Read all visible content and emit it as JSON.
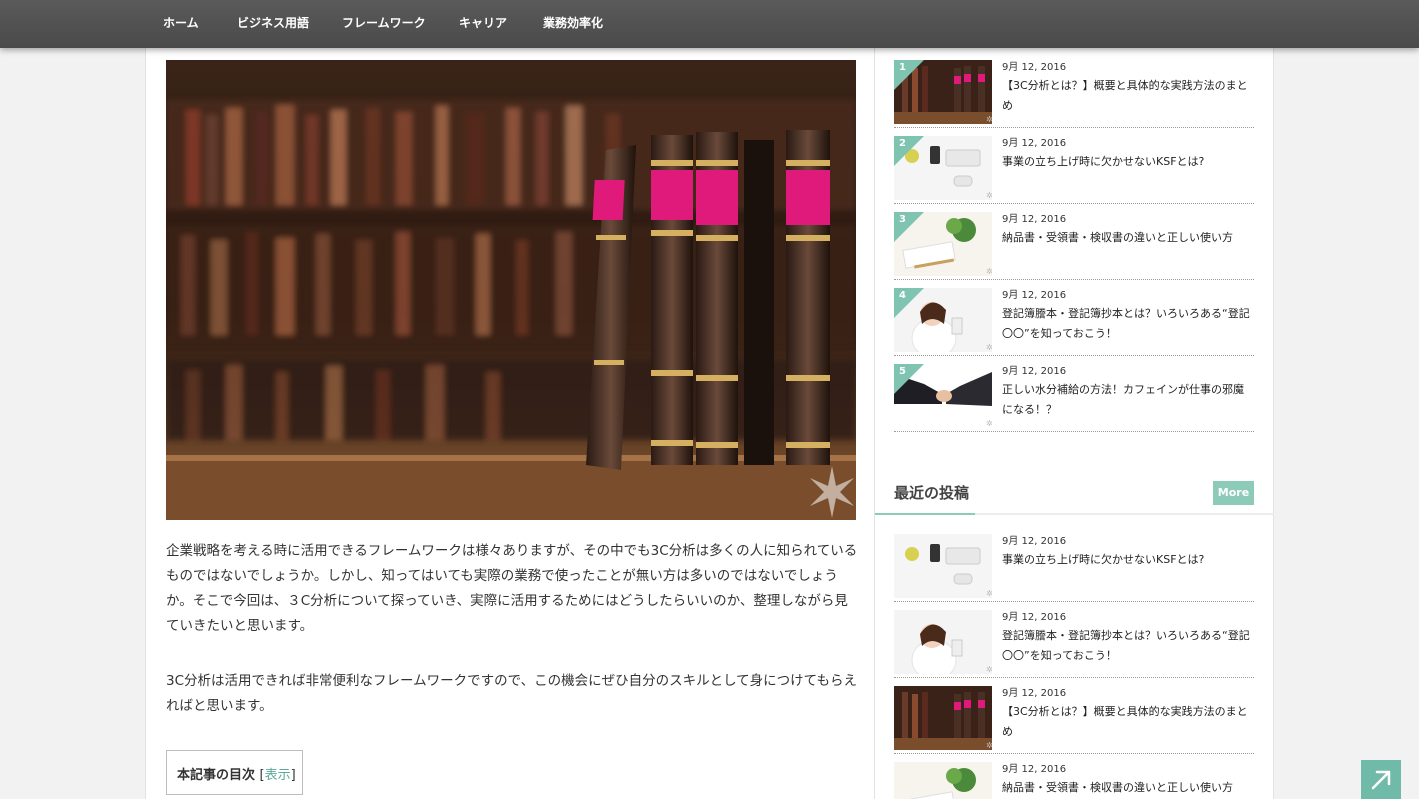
{
  "nav": {
    "items": [
      "ホーム",
      "ビジネス用語",
      "フレームワーク",
      "キャリア",
      "業務効率化"
    ]
  },
  "article": {
    "paragraph1": "企業戦略を考える時に活用できるフレームワークは様々ありますが、その中でも3C分析は多くの人に知られているものではないでしょうか。しかし、知ってはいても実際の業務で使ったことが無い方は多いのではないでしょうか。そこで今回は、３C分析について探っていき、実際に活用するためにはどうしたらいいのか、整理しながら見ていきたいと思います。",
    "paragraph2": "3C分析は活用できれば非常便利なフレームワークですので、この機会にぜひ自分のスキルとして身につけてもらえればと思います。",
    "toc_title": "本記事の目次",
    "toc_open": "[",
    "toc_toggle": "表示",
    "toc_close": "]"
  },
  "ranking": {
    "posts": [
      {
        "rank": "1",
        "date": "9月 12, 2016",
        "title": "【3C分析とは？】概要と具体的な実践方法のまとめ",
        "thumb": "books"
      },
      {
        "rank": "2",
        "date": "9月 12, 2016",
        "title": "事業の立ち上げ時に欠かせないKSFとは?",
        "thumb": "desk"
      },
      {
        "rank": "3",
        "date": "9月 12, 2016",
        "title": "納品書・受領書・検収書の違いと正しい使い方",
        "thumb": "plant"
      },
      {
        "rank": "4",
        "date": "9月 12, 2016",
        "title": "登記簿謄本・登記簿抄本とは？いろいろある“登記〇〇”を知っておこう！",
        "thumb": "woman"
      },
      {
        "rank": "5",
        "date": "9月 12, 2016",
        "title": "正しい水分補給の方法！カフェインが仕事の邪魔になる！？",
        "thumb": "handshake"
      }
    ]
  },
  "recent": {
    "title": "最近の投稿",
    "more_label": "More",
    "posts": [
      {
        "date": "9月 12, 2016",
        "title": "事業の立ち上げ時に欠かせないKSFとは?",
        "thumb": "desk"
      },
      {
        "date": "9月 12, 2016",
        "title": "登記簿謄本・登記簿抄本とは？いろいろある“登記〇〇”を知っておこう！",
        "thumb": "woman"
      },
      {
        "date": "9月 12, 2016",
        "title": "【3C分析とは？】概要と具体的な実践方法のまとめ",
        "thumb": "books"
      },
      {
        "date": "9月 12, 2016",
        "title": "納品書・受領書・検収書の違いと正しい使い方",
        "thumb": "plant"
      }
    ]
  },
  "colors": {
    "accent": "#8ccbb8",
    "nav_bg": "#4f4f4f",
    "link": "#5aa89a"
  }
}
